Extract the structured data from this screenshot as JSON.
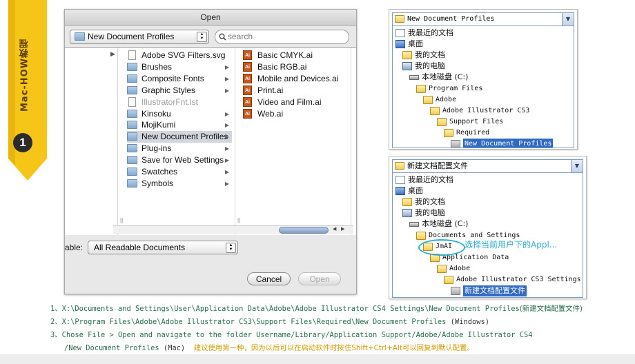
{
  "banner": {
    "vertical_text": "Mac-HOW教程",
    "step_number": "1",
    "color": "#f5c518"
  },
  "mac_dialog": {
    "title": "Open",
    "path_popup": "New Document Profiles",
    "search_placeholder": "search",
    "column1_items": [
      {
        "label": "Adobe SVG Filters.svg",
        "type": "file",
        "has_children": false
      },
      {
        "label": "Brushes",
        "type": "folder",
        "has_children": true
      },
      {
        "label": "Composite Fonts",
        "type": "folder",
        "has_children": true
      },
      {
        "label": "Graphic Styles",
        "type": "folder",
        "has_children": true
      },
      {
        "label": "IllustratorFnt.lst",
        "type": "file",
        "has_children": false,
        "dimmed": true
      },
      {
        "label": "Kinsoku",
        "type": "folder",
        "has_children": true
      },
      {
        "label": "MojiKumi",
        "type": "folder",
        "has_children": true
      },
      {
        "label": "New Document Profiles",
        "type": "folder",
        "has_children": true,
        "selected": true
      },
      {
        "label": "Plug-ins",
        "type": "folder",
        "has_children": true
      },
      {
        "label": "Save for Web Settings",
        "type": "folder",
        "has_children": true
      },
      {
        "label": "Swatches",
        "type": "folder",
        "has_children": true
      },
      {
        "label": "Symbols",
        "type": "folder",
        "has_children": true
      }
    ],
    "column2_items": [
      {
        "label": "Basic CMYK.ai",
        "type": "ai"
      },
      {
        "label": "Basic RGB.ai",
        "type": "ai"
      },
      {
        "label": "Mobile and Devices.ai",
        "type": "ai"
      },
      {
        "label": "Print.ai",
        "type": "ai"
      },
      {
        "label": "Video and Film.ai",
        "type": "ai"
      },
      {
        "label": "Web.ai",
        "type": "ai"
      }
    ],
    "enable_label": "able:",
    "enable_value": "All Readable Documents",
    "cancel_label": "Cancel",
    "open_label": "Open"
  },
  "win_top": {
    "combo": "New Document Profiles",
    "items": [
      {
        "label": "我最近的文档",
        "icon": "doc-icon",
        "indent": 0
      },
      {
        "label": "桌面",
        "icon": "desktop-icon",
        "indent": 0
      },
      {
        "label": "我的文档",
        "icon": "folder-icon",
        "indent": 1
      },
      {
        "label": "我的电脑",
        "icon": "computer-icon",
        "indent": 1
      },
      {
        "label": "本地磁盘 (C:)",
        "icon": "drive-icon",
        "indent": 2
      },
      {
        "label": "Program Files",
        "icon": "folder-icon",
        "indent": 3
      },
      {
        "label": "Adobe",
        "icon": "folder-icon",
        "indent": 4
      },
      {
        "label": "Adobe Illustrator CS3",
        "icon": "folder-icon",
        "indent": 5
      },
      {
        "label": "Support Files",
        "icon": "folder-icon",
        "indent": 6
      },
      {
        "label": "Required",
        "icon": "folder-icon",
        "indent": 7
      },
      {
        "label": "New Document Profiles",
        "icon": "folder-grey-icon",
        "indent": 8,
        "selected": true
      }
    ]
  },
  "win_bottom": {
    "combo": "新建文档配置文件",
    "items": [
      {
        "label": "我最近的文档",
        "icon": "doc-icon",
        "indent": 0
      },
      {
        "label": "桌面",
        "icon": "desktop-icon",
        "indent": 0
      },
      {
        "label": "我的文档",
        "icon": "folder-icon",
        "indent": 1
      },
      {
        "label": "我的电脑",
        "icon": "computer-icon",
        "indent": 1
      },
      {
        "label": "本地磁盘 (C:)",
        "icon": "drive-icon",
        "indent": 2
      },
      {
        "label": "Documents and Settings",
        "icon": "folder-icon",
        "indent": 3
      },
      {
        "label": "JmAI",
        "icon": "folder-icon",
        "indent": 4
      },
      {
        "label": "Application Data",
        "icon": "folder-icon",
        "indent": 5
      },
      {
        "label": "Adobe",
        "icon": "folder-icon",
        "indent": 6
      },
      {
        "label": "Adobe Illustrator CS3 Settings",
        "icon": "folder-icon",
        "indent": 7
      },
      {
        "label": "新建文档配置文件",
        "icon": "folder-grey-icon",
        "indent": 8,
        "selected": true
      }
    ],
    "annotation": "选择当前用户下的Appl..."
  },
  "instructions": {
    "line1_path": "1、X:\\Documents and Settings\\User\\Application Data\\Adobe\\Adobe Illustrator CS4 Settings\\New Document Profiles",
    "line1_zh": "(新建文档配置文件)",
    "line2_path": "2、X:\\Program Files\\Adobe\\Adobe Illustrator CS3\\Support Files\\Required\\New Document Profiles",
    "line2_platform": "(Windows)",
    "line3a": "3、Chose File > Open and navigate to the folder Username/Library/Application Support/Adobe/Adobe Illustrator CS4",
    "line3b": "/New Document Profiles",
    "line3_platform": "(Mac)",
    "line3_tip": "建议使用第一种，因为以后可以在启动软件时按住Shift+Ctrl+Alt可以回复到默认配置。"
  }
}
